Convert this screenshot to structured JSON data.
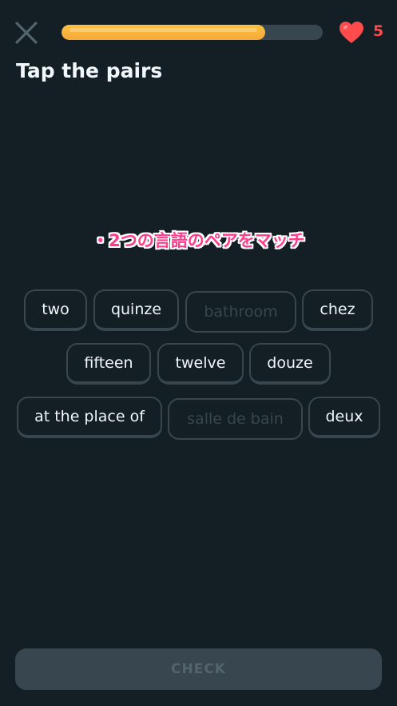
{
  "header": {
    "progress_percent": 78,
    "hearts_count": "5"
  },
  "title": "Tap the pairs",
  "caption": "・2つの言語のペアをマッチ",
  "word_rows": [
    [
      {
        "label": "two",
        "enabled": true
      },
      {
        "label": "quinze",
        "enabled": true
      },
      {
        "label": "bathroom",
        "enabled": false
      },
      {
        "label": "chez",
        "enabled": true
      }
    ],
    [
      {
        "label": "fifteen",
        "enabled": true
      },
      {
        "label": "twelve",
        "enabled": true
      },
      {
        "label": "douze",
        "enabled": true
      }
    ],
    [
      {
        "label": "at the place of",
        "enabled": true
      },
      {
        "label": "salle de bain",
        "enabled": false
      },
      {
        "label": "deux",
        "enabled": true
      }
    ]
  ],
  "check_label": "CHECK",
  "icons": {
    "close": "close-icon",
    "heart": "heart-icon"
  },
  "colors": {
    "background": "#131f24",
    "progress": "#f7b03c",
    "heart": "#ff4b4b",
    "tile_border": "#37464f",
    "caption": "#ff3c8c"
  }
}
